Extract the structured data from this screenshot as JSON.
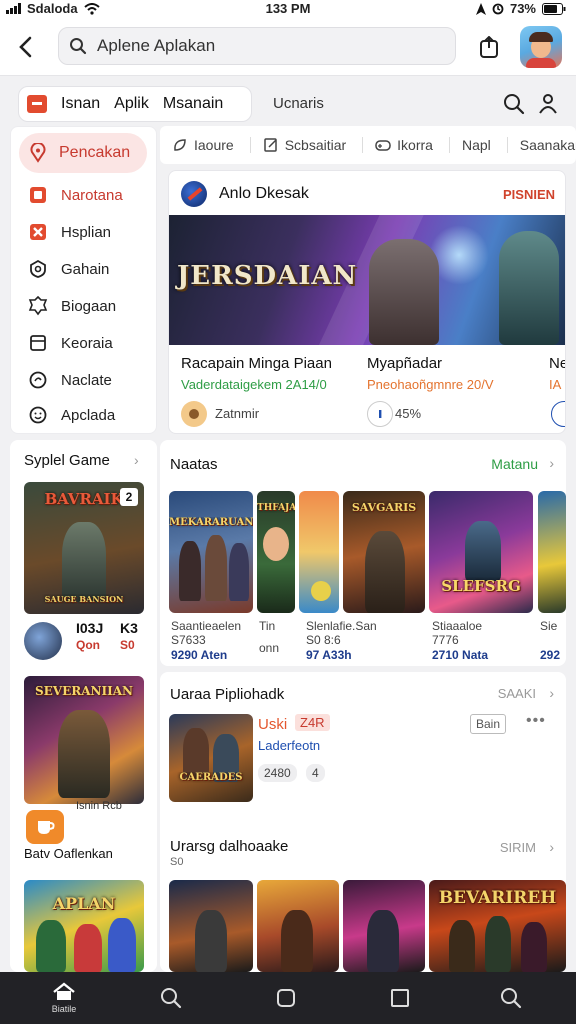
{
  "status_bar": {
    "carrier": "Sdaloda",
    "time": "133 PM",
    "battery": "73%"
  },
  "search": {
    "value": "Aplene Aplakan"
  },
  "categories": {
    "items": [
      "Isnan",
      "Aplik",
      "Msanain"
    ],
    "extra": "Ucnaris"
  },
  "sidebar": {
    "items": [
      {
        "label": "Pencakan",
        "icon": "location-pin-icon"
      },
      {
        "label": "Narotana",
        "icon": "app-square-icon"
      },
      {
        "label": "Hsplian",
        "icon": "tools-icon"
      },
      {
        "label": "Gahain",
        "icon": "shield-icon"
      },
      {
        "label": "Biogaan",
        "icon": "badge-icon"
      },
      {
        "label": "Keoraia",
        "icon": "document-icon"
      },
      {
        "label": "Naclate",
        "icon": "chat-icon"
      },
      {
        "label": "Apclada",
        "icon": "smile-icon"
      }
    ]
  },
  "subtabs": [
    "Iaoure",
    "Scbsaitiar",
    "Ikorra",
    "Napl",
    "Saanakan"
  ],
  "featured": {
    "title": "Anlo Dkesak",
    "badge": "PISNIEN",
    "banner_title": "JERSDAIAN",
    "cards": [
      {
        "name": "Racapain Minga Piaan",
        "subtitle": "Vaderdataigekem 2A14/0",
        "meta": "Zatnmir"
      },
      {
        "name": "Myapñadar",
        "subtitle": "Pneohaoñgmnre 20/V",
        "meta": "45%"
      },
      {
        "name": "Ne",
        "subtitle": "IA",
        "meta": ""
      }
    ]
  },
  "left_panel": {
    "title": "Syplel Game",
    "tile1": {
      "label": "BAVRAIK",
      "badge": "2",
      "banner": "SAUGE BANSION"
    },
    "row": {
      "line1": "I03J",
      "line2": "Qon",
      "line3": "K3",
      "line4": "S0"
    },
    "tile2": {
      "label": "SEVERANIIAN",
      "caption": "Isnin Rcb"
    },
    "cta": "Batv Oaflenkan",
    "tile3": {
      "label": "APLAN"
    }
  },
  "new_section": {
    "title": "Naatas",
    "more": "Matanu",
    "cards": [
      {
        "art": "MEKARARUAN",
        "name": "Saantieaelen",
        "meta": "S7633",
        "price": "9290 Aten"
      },
      {
        "art": "THFAJA",
        "name": "Tin",
        "meta": "",
        "price": "onn"
      },
      {
        "art": "",
        "name": "Slenlafie.San",
        "meta": "S0 8:6",
        "price": "97 A33h"
      },
      {
        "art": "SAVGARIS",
        "name": "",
        "meta": "",
        "price": ""
      },
      {
        "art": "SLEFSRG",
        "name": "Stiaaaloe",
        "meta": "7776",
        "price": "2710 Nata"
      },
      {
        "art": "",
        "name": "Sie",
        "meta": "",
        "price": "292"
      }
    ]
  },
  "popular": {
    "title": "Uaraa Pipliohadk",
    "more": "SAAKI",
    "app": {
      "name": "Uski",
      "tag": "Z4R",
      "developer": "Laderfeotn",
      "chips": [
        "2480",
        "4"
      ],
      "button": "Bain",
      "art": "CAERADES"
    }
  },
  "popular2": {
    "title": "Urarsg dalhoaake",
    "subtitle": "S0",
    "more": "SIRIM"
  },
  "bottom_row": {
    "art": [
      "",
      "",
      "",
      "BEVARIREH"
    ]
  },
  "bottom_nav": {
    "home_label": "Biatile"
  }
}
